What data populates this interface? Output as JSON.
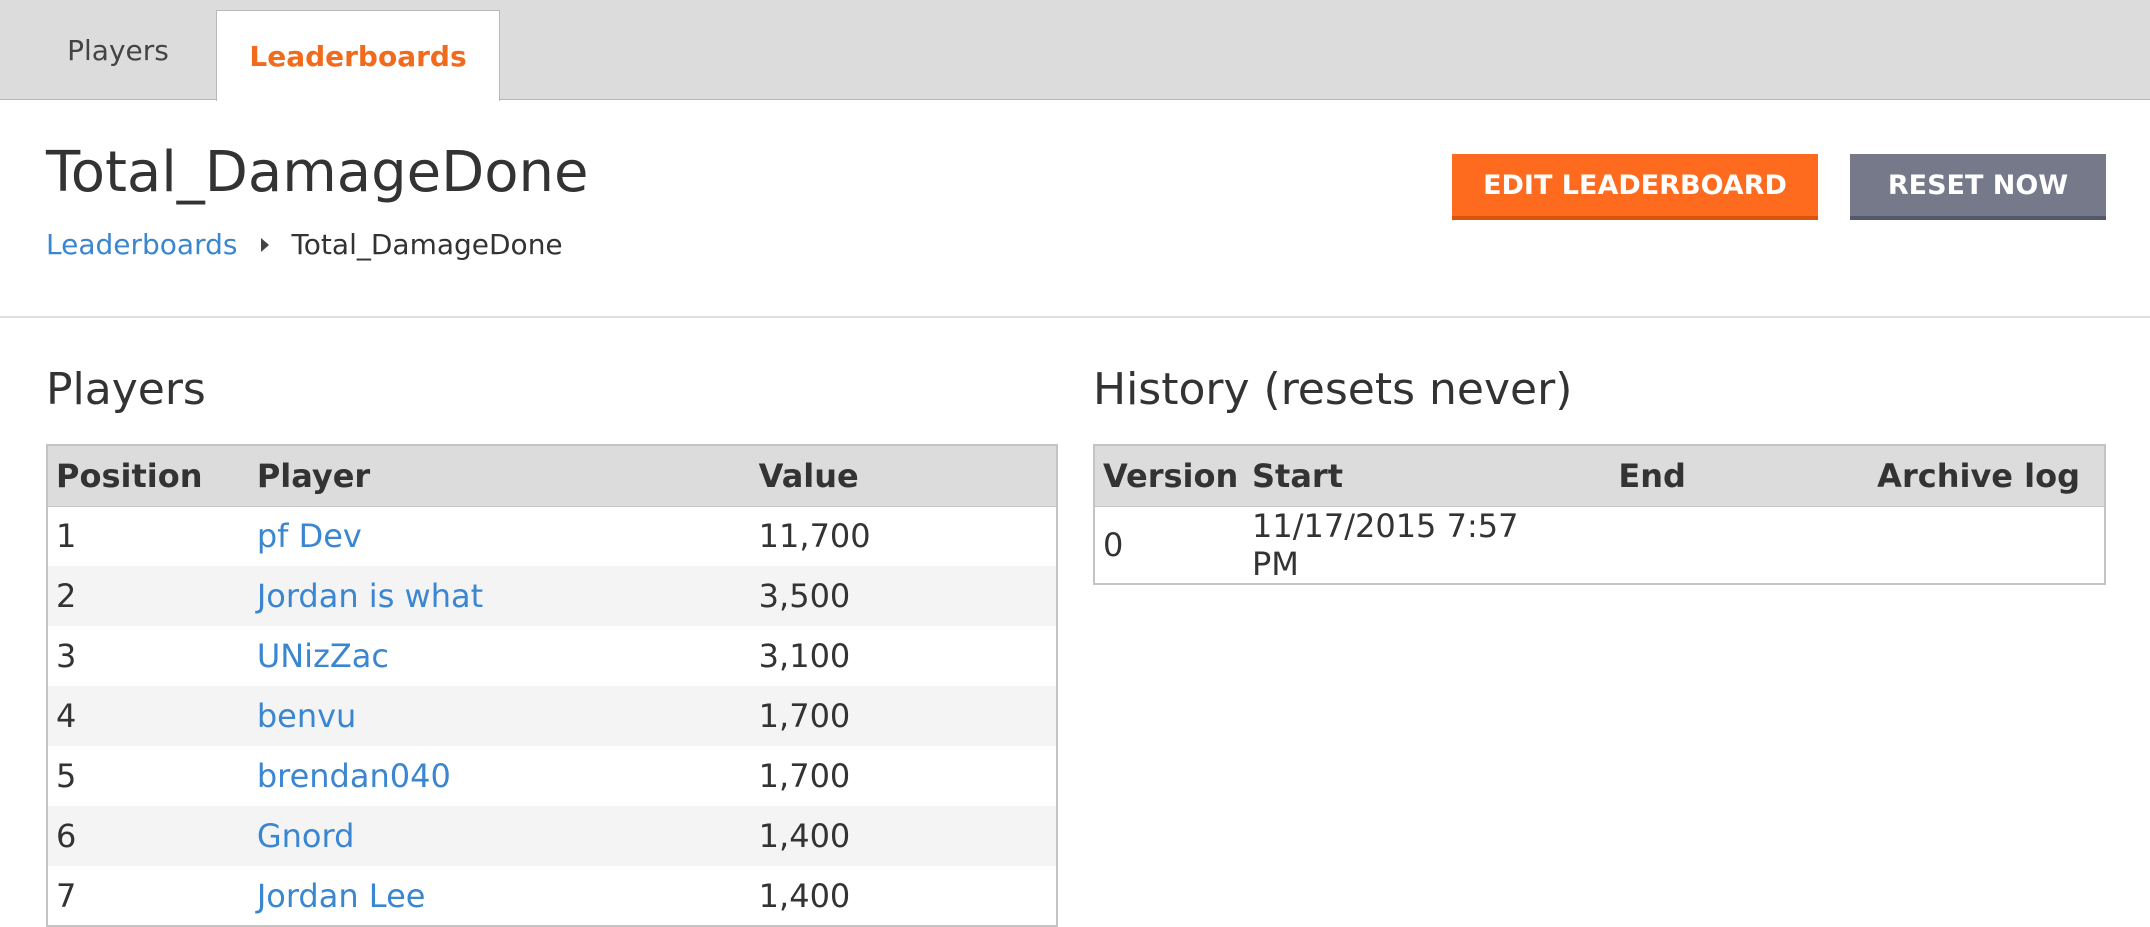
{
  "tabs": {
    "players": "Players",
    "leaderboards": "Leaderboards"
  },
  "header": {
    "title": "Total_DamageDone",
    "breadcrumb": {
      "parent": "Leaderboards",
      "current": "Total_DamageDone"
    },
    "edit_label": "EDIT LEADERBOARD",
    "reset_label": "RESET NOW"
  },
  "players": {
    "title": "Players",
    "columns": [
      "Position",
      "Player",
      "Value"
    ],
    "rows": [
      {
        "position": "1",
        "player": "pf Dev",
        "value": "11,700"
      },
      {
        "position": "2",
        "player": "Jordan is what",
        "value": "3,500"
      },
      {
        "position": "3",
        "player": "UNizZac",
        "value": "3,100"
      },
      {
        "position": "4",
        "player": "benvu",
        "value": "1,700"
      },
      {
        "position": "5",
        "player": "brendan040",
        "value": "1,700"
      },
      {
        "position": "6",
        "player": "Gnord",
        "value": "1,400"
      },
      {
        "position": "7",
        "player": "Jordan Lee",
        "value": "1,400"
      }
    ]
  },
  "history": {
    "title": "History (resets never)",
    "columns": [
      "Version",
      "Start",
      "End",
      "Archive log"
    ],
    "rows": [
      {
        "version": "0",
        "start": "11/17/2015 7:57 PM",
        "end": "",
        "archive": ""
      }
    ]
  },
  "colors": {
    "accent": "#f26b1d",
    "edit_button": "#ff6b1e",
    "reset_button": "#76798a",
    "link": "#3b86d1",
    "tab_bar": "#dcdcdc"
  }
}
